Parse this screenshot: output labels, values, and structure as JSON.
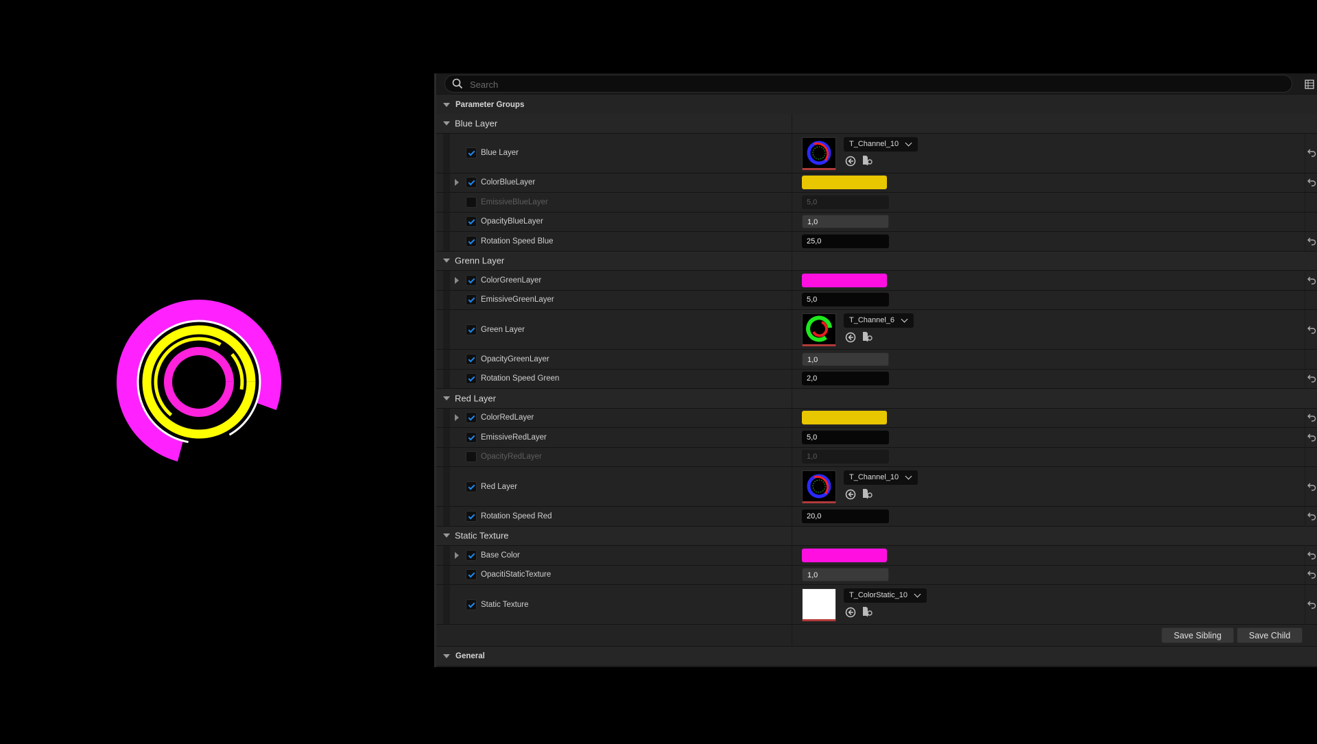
{
  "search": {
    "placeholder": "Search"
  },
  "sections": {
    "parameter_groups": "Parameter Groups",
    "general": "General"
  },
  "buttons": {
    "save_sibling": "Save Sibling",
    "save_child": "Save Child"
  },
  "groups": [
    {
      "title": "Blue Layer",
      "params": [
        {
          "label": "Blue Layer",
          "type": "texture",
          "enabled": true,
          "expandable": false,
          "asset": "T_Channel_10",
          "thumb": "blue-red-ring",
          "reset": true
        },
        {
          "label": "ColorBlueLayer",
          "type": "color",
          "enabled": true,
          "expandable": true,
          "color": "#e8c600",
          "reset": true
        },
        {
          "label": "EmissiveBlueLayer",
          "type": "number",
          "enabled": false,
          "value": "5,0",
          "style": "disabled",
          "reset": false
        },
        {
          "label": "OpacityBlueLayer",
          "type": "number",
          "enabled": true,
          "value": "1,0",
          "style": "gray",
          "reset": false
        },
        {
          "label": "Rotation Speed Blue",
          "type": "number",
          "enabled": true,
          "value": "25,0",
          "style": "black",
          "reset": true
        }
      ]
    },
    {
      "title": "Grenn Layer",
      "params": [
        {
          "label": "ColorGreenLayer",
          "type": "color",
          "enabled": true,
          "expandable": true,
          "color": "#ff10e0",
          "reset": true
        },
        {
          "label": "EmissiveGreenLayer",
          "type": "number",
          "enabled": true,
          "value": "5,0",
          "style": "black",
          "reset": false
        },
        {
          "label": "Green Layer",
          "type": "texture",
          "enabled": true,
          "expandable": false,
          "asset": "T_Channel_6",
          "thumb": "green-red-ring",
          "reset": true
        },
        {
          "label": "OpacityGreenLayer",
          "type": "number",
          "enabled": true,
          "value": "1,0",
          "style": "gray",
          "reset": false
        },
        {
          "label": "Rotation Speed Green",
          "type": "number",
          "enabled": true,
          "value": "2,0",
          "style": "black",
          "reset": true
        }
      ]
    },
    {
      "title": "Red Layer",
      "params": [
        {
          "label": "ColorRedLayer",
          "type": "color",
          "enabled": true,
          "expandable": true,
          "color": "#e8c600",
          "reset": true
        },
        {
          "label": "EmissiveRedLayer",
          "type": "number",
          "enabled": true,
          "value": "5,0",
          "style": "black",
          "reset": true
        },
        {
          "label": "OpacityRedLayer",
          "type": "number",
          "enabled": false,
          "value": "1,0",
          "style": "disabled",
          "reset": false
        },
        {
          "label": "Red Layer",
          "type": "texture",
          "enabled": true,
          "expandable": false,
          "asset": "T_Channel_10",
          "thumb": "blue-red-ring",
          "reset": true
        },
        {
          "label": "Rotation Speed Red",
          "type": "number",
          "enabled": true,
          "value": "20,0",
          "style": "black",
          "reset": true
        }
      ]
    },
    {
      "title": "Static Texture",
      "params": [
        {
          "label": "Base Color",
          "type": "color",
          "enabled": true,
          "expandable": true,
          "color": "#ff10e0",
          "reset": true
        },
        {
          "label": "OpacitiStaticTexture",
          "type": "number",
          "enabled": true,
          "value": "1,0",
          "style": "gray",
          "reset": true
        },
        {
          "label": "Static Texture",
          "type": "texture",
          "enabled": true,
          "expandable": false,
          "asset": "T_ColorStatic_10",
          "thumb": "white",
          "reset": true
        }
      ]
    }
  ],
  "preview_colors": {
    "outer": "#ff22ff",
    "ring": "#ffff00",
    "inner": "#ff22dd",
    "accent": "#ffffff"
  }
}
